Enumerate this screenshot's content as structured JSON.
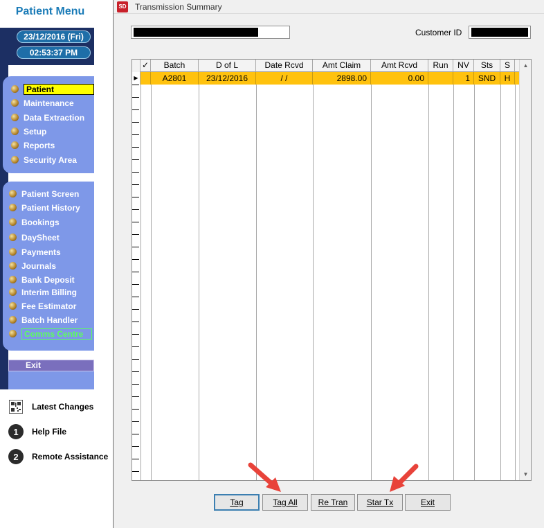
{
  "sidebar": {
    "title": "Patient Menu",
    "date": "23/12/2016 (Fri)",
    "time": "02:53:37 PM",
    "primary_items": [
      {
        "label": "Patient",
        "icon": "gold-ball-icon"
      },
      {
        "label": "Maintenance",
        "icon": "gold-ball-icon"
      },
      {
        "label": "Data Extraction",
        "icon": "gold-ball-icon"
      },
      {
        "label": "Setup",
        "icon": "gold-ball-icon"
      },
      {
        "label": "Reports",
        "icon": "gold-ball-icon"
      },
      {
        "label": "Security Area",
        "icon": "gold-ball-icon"
      }
    ],
    "secondary_items": [
      {
        "label": "Patient Screen"
      },
      {
        "label": "Patient History"
      },
      {
        "label": "Bookings"
      },
      {
        "label": "DaySheet"
      },
      {
        "label": "Payments"
      },
      {
        "label": "Journals"
      },
      {
        "label": "Bank Deposit"
      },
      {
        "label": "Interim Billing"
      },
      {
        "label": "Fee Estimator"
      },
      {
        "label": "Batch Handler"
      },
      {
        "label": "Comms Centre"
      }
    ],
    "exit_label": "Exit",
    "links": [
      {
        "label": "Latest Changes",
        "icon": "qr-code-icon"
      },
      {
        "label": "Help File",
        "icon": "number-1-icon",
        "glyph": "1"
      },
      {
        "label": "Remote Assistance",
        "icon": "number-2-icon",
        "glyph": "2"
      }
    ],
    "colors": {
      "accent": "#1a7bb7",
      "panel": "#7e98e8",
      "navy": "#1c2f63",
      "highlight": "#ffff00",
      "active_green": "#5cff5c"
    }
  },
  "window": {
    "icon_text": "SD",
    "title": "Transmission Summary",
    "customer_id_label": "Customer ID"
  },
  "grid": {
    "columns": [
      "✓",
      "Batch",
      "D of L",
      "Date Rcvd",
      "Amt Claim",
      "Amt Rcvd",
      "Run",
      "NV",
      "Sts",
      "S"
    ],
    "rows": [
      {
        "check": "",
        "batch": "A2801",
        "dol": "23/12/2016",
        "date_rcvd": "/ /",
        "amt_claim": "2898.00",
        "amt_rcvd": "0.00",
        "run": "",
        "nv": "1",
        "sts": "SND",
        "s": "H"
      }
    ],
    "selected_row_color": "#ffc20e"
  },
  "buttons": {
    "tag": "Tag",
    "tag_all": "Tag All",
    "re_tran": "Re Tran",
    "star_tx": "Star Tx",
    "exit": "Exit"
  }
}
